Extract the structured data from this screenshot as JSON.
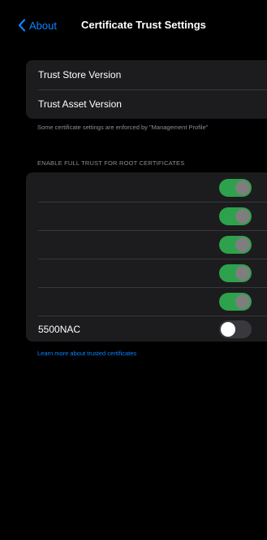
{
  "nav": {
    "back_label": "About",
    "title": "Certificate Trust Settings",
    "back_icon": "chevron-left-icon"
  },
  "versions": {
    "items": [
      {
        "label": "Trust Store Version"
      },
      {
        "label": "Trust Asset Version"
      }
    ]
  },
  "footnote": "Some certificate settings are enforced by \"Management Profile\"",
  "trust_section": {
    "header": "ENABLE FULL TRUST FOR ROOT CERTIFICATES",
    "certificates": [
      {
        "name": "",
        "enabled": true
      },
      {
        "name": "",
        "enabled": true
      },
      {
        "name": "",
        "enabled": true
      },
      {
        "name": "",
        "enabled": true
      },
      {
        "name": "",
        "enabled": true
      },
      {
        "name": "5500NAC",
        "enabled": false
      }
    ]
  },
  "learn_more": "Learn more about trusted certificates",
  "colors": {
    "accent": "#0a84ff",
    "toggle_on": "#34c759",
    "toggle_off": "#39393d",
    "group_background": "#1c1c1e",
    "secondary_text": "#8e8e93"
  }
}
